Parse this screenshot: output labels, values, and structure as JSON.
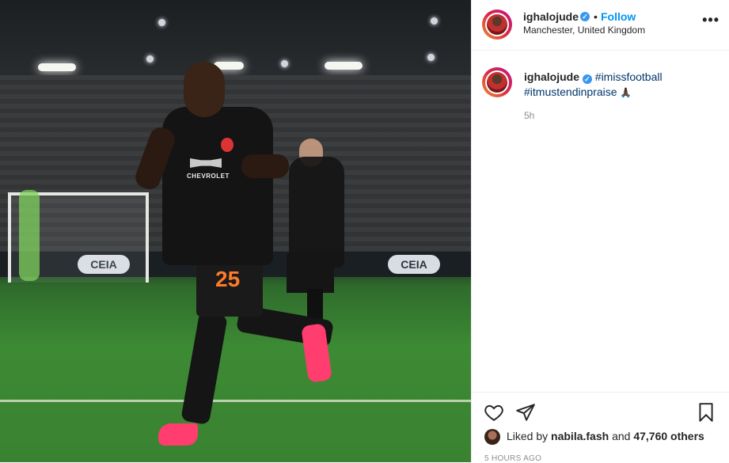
{
  "post": {
    "username": "ighalojude",
    "follow_label": "Follow",
    "separator": "•",
    "location": "Manchester, United Kingdom",
    "more_label": "•••",
    "caption": {
      "username": "ighalojude",
      "hashtag1": "#imissfootball",
      "hashtag2": "#itmustendinpraise",
      "emoji": "🙏🏿"
    },
    "time": "5h",
    "likes": {
      "prefix": "Liked by",
      "user": "nabila.fash",
      "middle": "and",
      "count": "47,760 others"
    },
    "ago": "5 HOURS AGO"
  },
  "photo": {
    "jersey_number": "25",
    "sponsor": "CHEVROLET",
    "board_text": "CEIA"
  },
  "colors": {
    "follow": "#0095f6",
    "verified": "#3897f0",
    "hashtag": "#00376b",
    "muted": "#8e8e8e"
  },
  "icons": [
    "verified-badge-icon",
    "more-options-icon",
    "heart-icon",
    "share-icon",
    "bookmark-icon"
  ]
}
